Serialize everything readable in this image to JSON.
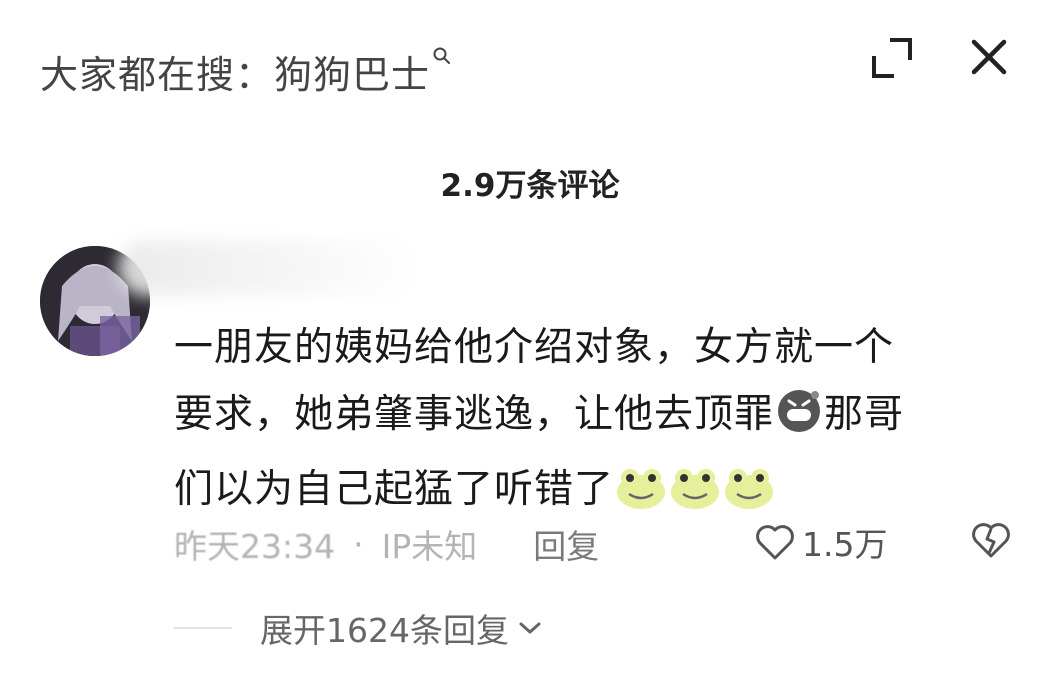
{
  "header": {
    "search_hint": "大家都在搜：狗狗巴士",
    "search_icon": "search-icon",
    "expand_icon": "fullscreen-exit-icon",
    "close_icon": "close-icon"
  },
  "comments_header": {
    "count_label": "2.9万条评论"
  },
  "comment": {
    "line1": "一朋友的姨妈给他介绍对象，女方就一个",
    "line2_before": "要求，她弟肇事逃逸，让他去顶罪",
    "line2_after": "那哥",
    "line3": "们以为自己起猛了听错了",
    "time": "昨天23:34",
    "dot": "·",
    "ip": "IP未知",
    "reply_label": "回复",
    "like_count": "1.5万",
    "expand_replies": "展开1624条回复"
  },
  "colors": {
    "text": "#1a1a1a",
    "muted": "#b4b4b4",
    "secondary": "#666666"
  }
}
